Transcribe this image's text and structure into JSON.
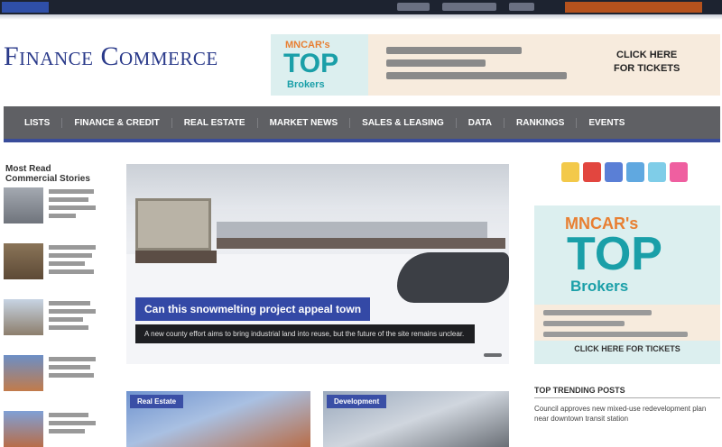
{
  "site": {
    "logo_text": "Finance Commerce"
  },
  "top_bar": {
    "colors": {
      "background": "#1d2330",
      "home": "#2f4fa8",
      "subscribe": "#b5521d"
    }
  },
  "banner_ad": {
    "badge": {
      "line1": "MNCAR's",
      "line2": "TOP",
      "line3": "Brokers"
    },
    "cta": [
      "CLICK HERE",
      "FOR TICKETS"
    ]
  },
  "nav": {
    "items": [
      "Lists",
      "Finance & Credit",
      "Real Estate",
      "Market News",
      "Sales & Leasing",
      "Data",
      "Rankings",
      "Events"
    ],
    "colors": {
      "background": "#5f6064",
      "underline": "#394c9a"
    }
  },
  "sidebar": {
    "heading": "Most Read Commercial Stories",
    "items": [
      {
        "thumb_color": "#8a8f98"
      },
      {
        "thumb_color": "#7a6650"
      },
      {
        "thumb_color": "#9a8b7a"
      },
      {
        "thumb_color": "#5a7ab0"
      },
      {
        "thumb_color": "#b07050"
      }
    ]
  },
  "hero": {
    "title": "Can this snowmelting project appeal town",
    "caption": "A new county effort aims to bring industrial land into reuse, but the future of the site remains unclear."
  },
  "cards": [
    {
      "tag": "Real Estate",
      "color": "#5c7fb8"
    },
    {
      "tag": "Development",
      "color": "#7d8da0"
    }
  ],
  "right_rail": {
    "social_colors": [
      "#f3c94a",
      "#e2463f",
      "#5a7fd6",
      "#60a8e0",
      "#7fcde8",
      "#ef5fa0"
    ],
    "ad": {
      "line1": "MNCAR's",
      "line2": "TOP",
      "line3": "Brokers",
      "cta": "CLICK HERE FOR TICKETS"
    },
    "trending": {
      "title": "Top Trending Posts",
      "first": "Council approves new mixed-use redevelopment plan near downtown transit station"
    }
  }
}
